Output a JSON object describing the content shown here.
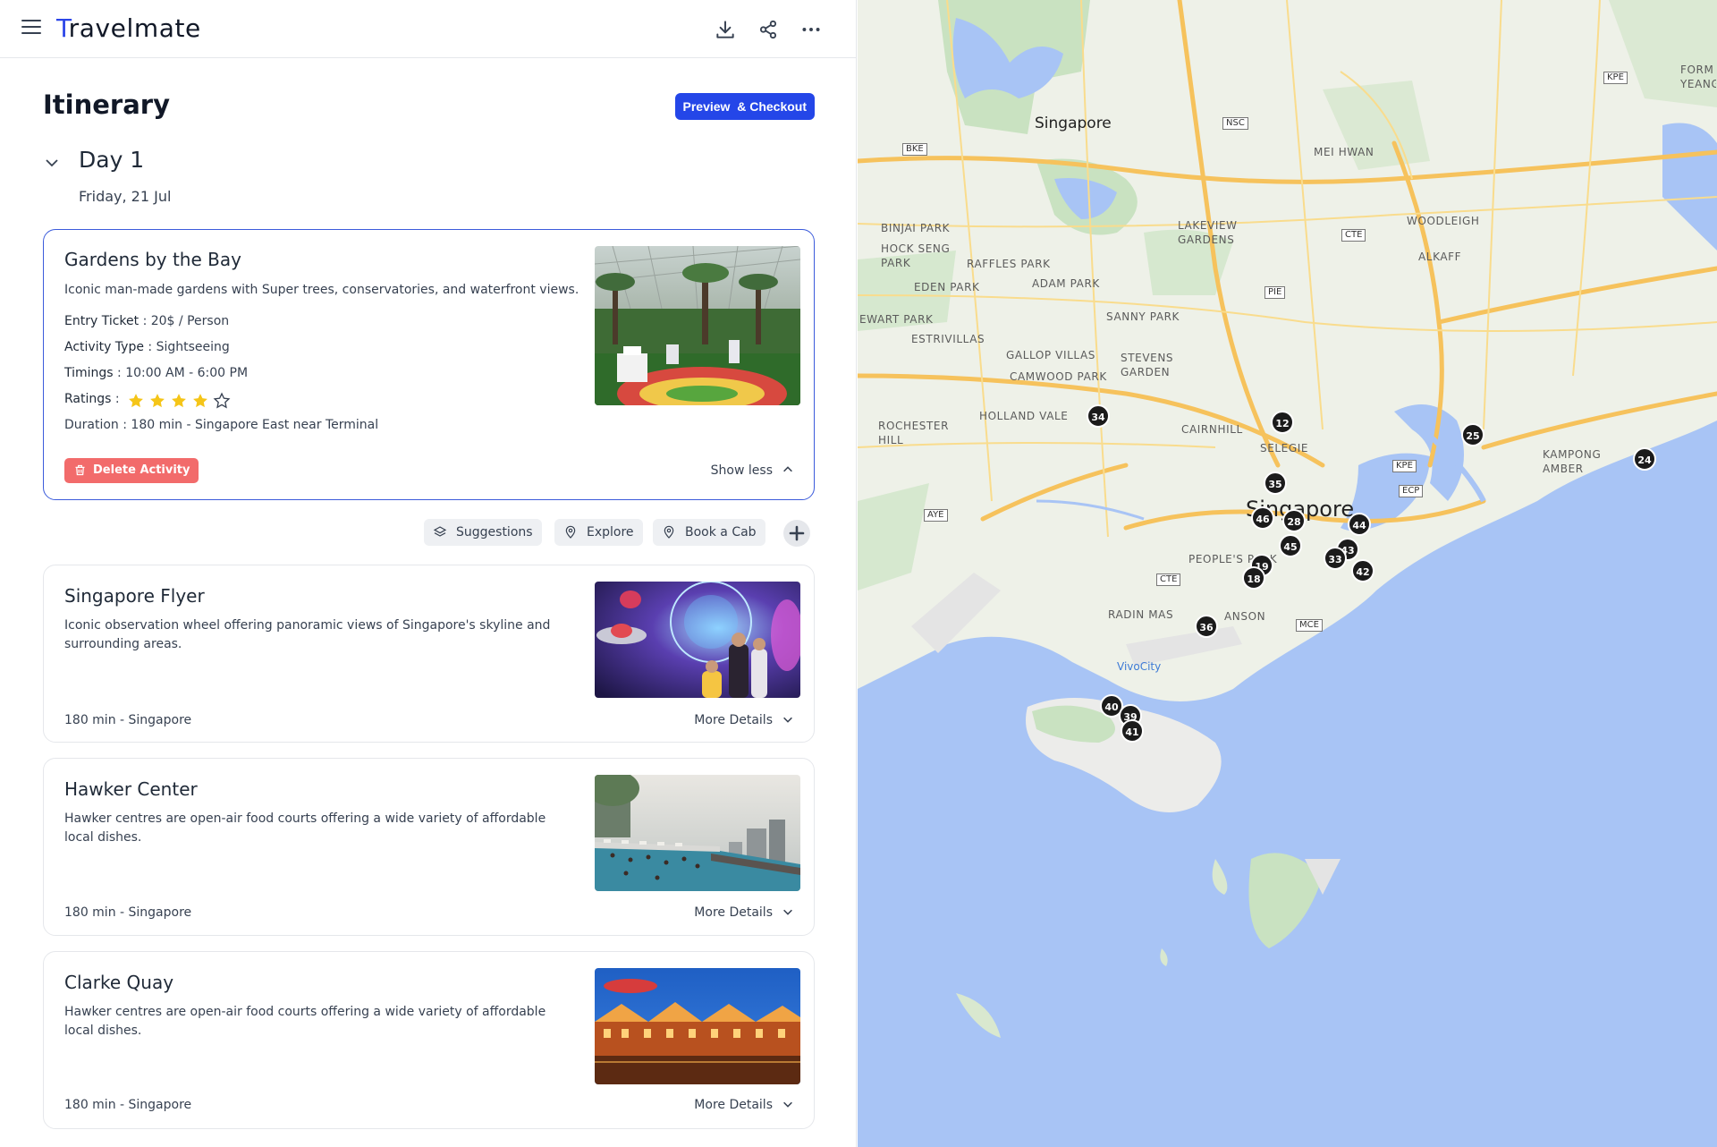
{
  "app": {
    "logo_first": "T",
    "logo_rest": "ravelmate",
    "icons": [
      "menu-icon",
      "download-icon",
      "share-icon",
      "more-icon"
    ]
  },
  "page": {
    "title": "Itinerary",
    "checkout_label": "Preview  & Checkout",
    "day_label": "Day 1",
    "day_date": "Friday, 21 Jul"
  },
  "activity": {
    "title": "Gardens by the Bay",
    "description": "Iconic man-made gardens with Super trees, conservatories, and waterfront views.",
    "entry_label": "Entry Ticket",
    "entry_value": " : 20$ / Person",
    "type_label": "Activity Type",
    "type_value": " : Sightseeing",
    "timings_label": "Timings",
    "timings_value": " : 10:00 AM - 6:00 PM",
    "ratings_label": "Ratings",
    "ratings_sep": " :",
    "rating": 4,
    "rating_max": 5,
    "duration": "Duration : 180 min - Singapore East near Terminal",
    "delete_label": "Delete Activity",
    "toggle_label": "Show less"
  },
  "actions": {
    "suggestions": "Suggestions",
    "explore": "Explore",
    "book_cab": "Book a Cab"
  },
  "cards": [
    {
      "title": "Singapore Flyer",
      "description": "Iconic observation wheel offering panoramic views of Singapore's skyline and surrounding areas.",
      "meta": "180 min - Singapore",
      "toggle": "More Details"
    },
    {
      "title": "Hawker Center",
      "description": "Hawker centres are open-air food courts offering a wide variety of affordable local dishes.",
      "meta": "180 min - Singapore",
      "toggle": "More Details"
    },
    {
      "title": "Clarke Quay",
      "description": "Hawker centres are open-air food courts offering a wide variety of affordable local dishes.",
      "meta": "180 min - Singapore",
      "toggle": "More Details"
    }
  ],
  "map": {
    "labels": [
      "Singapore",
      "MEI HWAN",
      "WOODLEIGH",
      "ALKAFF",
      "BINJAI PARK",
      "HOCK SENG PARK",
      "RAFFLES PARK",
      "EDEN PARK",
      "ADAM PARK",
      "LAKEVIEW GARDENS",
      "SANNY PARK",
      "EWART PARK",
      "ESTRIVILLAS",
      "GALLOP VILLAS",
      "STEVENS GARDEN",
      "CAMWOOD PARK",
      "HOLLAND VALE",
      "CAIRNHILL",
      "SELEGIE",
      "ROCHESTER HILL",
      "KAMPONG AMBER",
      "PEOPLE'S PARK",
      "RADIN MAS",
      "ANSON",
      "VivoCity",
      "Singapore",
      "FORM YEANG"
    ],
    "roads": [
      "BKE",
      "NSC",
      "CTE",
      "PIE",
      "KPE",
      "ECP",
      "AYE",
      "CTE",
      "MCE",
      "KPE"
    ],
    "markers": [
      "12",
      "25",
      "24",
      "34",
      "35",
      "46",
      "28",
      "44",
      "45",
      "43",
      "33",
      "42",
      "19",
      "18",
      "36",
      "40",
      "39",
      "41"
    ]
  },
  "colors": {
    "accent": "#2446e8",
    "delete": "#f26b6b",
    "star": "#f5c518",
    "water": "#a8c4f5",
    "land": "#eef1e8"
  }
}
